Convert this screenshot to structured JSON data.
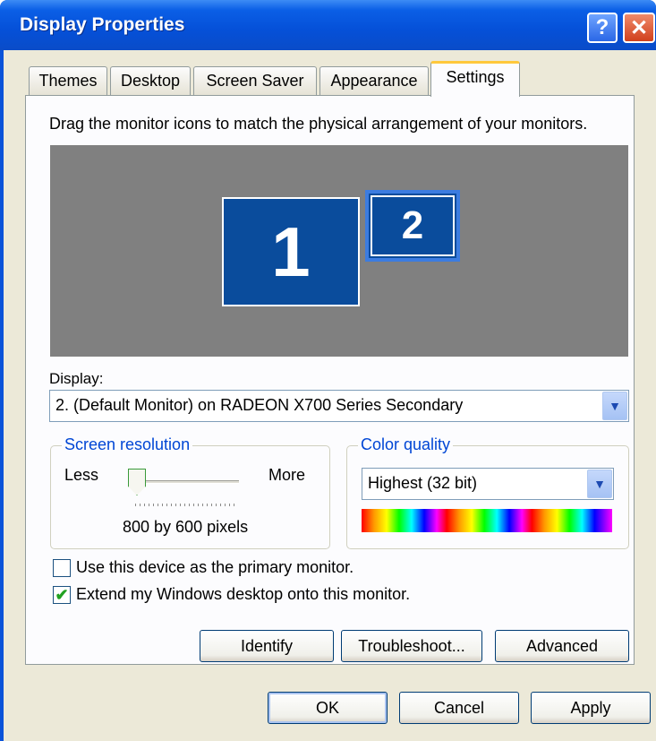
{
  "window": {
    "title": "Display Properties",
    "help_glyph": "?",
    "close_glyph": "✕"
  },
  "tabs": [
    {
      "label": "Themes"
    },
    {
      "label": "Desktop"
    },
    {
      "label": "Screen Saver"
    },
    {
      "label": "Appearance"
    },
    {
      "label": "Settings",
      "active": true
    }
  ],
  "settings": {
    "instructions": "Drag the monitor icons to match the physical arrangement of your monitors.",
    "monitors": [
      {
        "label": "1"
      },
      {
        "label": "2",
        "selected": true
      }
    ],
    "display_label": "Display:",
    "display_value": "2. (Default Monitor) on RADEON X700 Series Secondary",
    "dropdown_glyph": "▼",
    "screen_resolution": {
      "title": "Screen resolution",
      "less": "Less",
      "more": "More",
      "slider_level": 0,
      "value": "800 by 600 pixels"
    },
    "color_quality": {
      "title": "Color quality",
      "value": "Highest (32 bit)"
    },
    "primary_checkbox": {
      "label": "Use this device as the primary monitor.",
      "checked": false
    },
    "extend_checkbox": {
      "label": "Extend my Windows desktop onto this monitor.",
      "checked": true,
      "check_glyph": "✔"
    },
    "buttons": {
      "identify": "Identify",
      "troubleshoot": "Troubleshoot...",
      "advanced": "Advanced"
    }
  },
  "footer": {
    "ok": "OK",
    "cancel": "Cancel",
    "apply": "Apply"
  },
  "colors": {
    "titlebar": "#0550d8",
    "dialog_bg": "#ece9d8",
    "monitor": "#0a4c9c",
    "group_title": "#0046d5"
  }
}
